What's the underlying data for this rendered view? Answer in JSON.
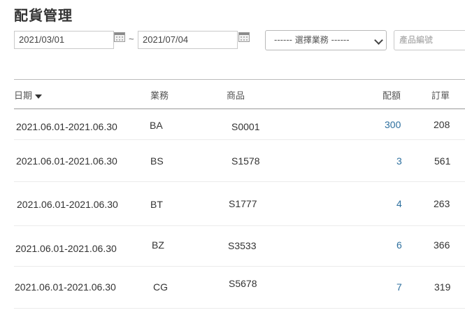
{
  "page": {
    "title": "配貨管理"
  },
  "filters": {
    "start_date": "2021/03/01",
    "end_date": "2021/07/04",
    "date_separator": "~",
    "salesperson_select": "------ 選擇業務 ------",
    "product_placeholder": "產品編號"
  },
  "table": {
    "columns": {
      "date": "日期",
      "salesperson": "業務",
      "product": "商品",
      "allocation": "配額",
      "orders": "訂單"
    },
    "rows": [
      {
        "date": "2021.06.01-2021.06.30",
        "salesperson": "BA",
        "product": "S0001",
        "allocation": "300",
        "orders": "208"
      },
      {
        "date": "2021.06.01-2021.06.30",
        "salesperson": "BS",
        "product": "S1578",
        "allocation": "3",
        "orders": "561"
      },
      {
        "date": "2021.06.01-2021.06.30",
        "salesperson": "BT",
        "product": "S1777",
        "allocation": "4",
        "orders": "263"
      },
      {
        "date": "2021.06.01-2021.06.30",
        "salesperson": "BZ",
        "product": "S3533",
        "allocation": "6",
        "orders": "366"
      },
      {
        "date": "2021.06.01-2021.06.30",
        "salesperson": "CG",
        "product": "S5678",
        "allocation": "7",
        "orders": "319"
      }
    ]
  },
  "colors": {
    "link": "#2d6f9e",
    "text": "#333333",
    "border": "#bbbbbb"
  },
  "icons": {
    "calendar": "calendar-icon",
    "sort": "caret-down-icon",
    "dropdown": "chevron-down-icon"
  }
}
